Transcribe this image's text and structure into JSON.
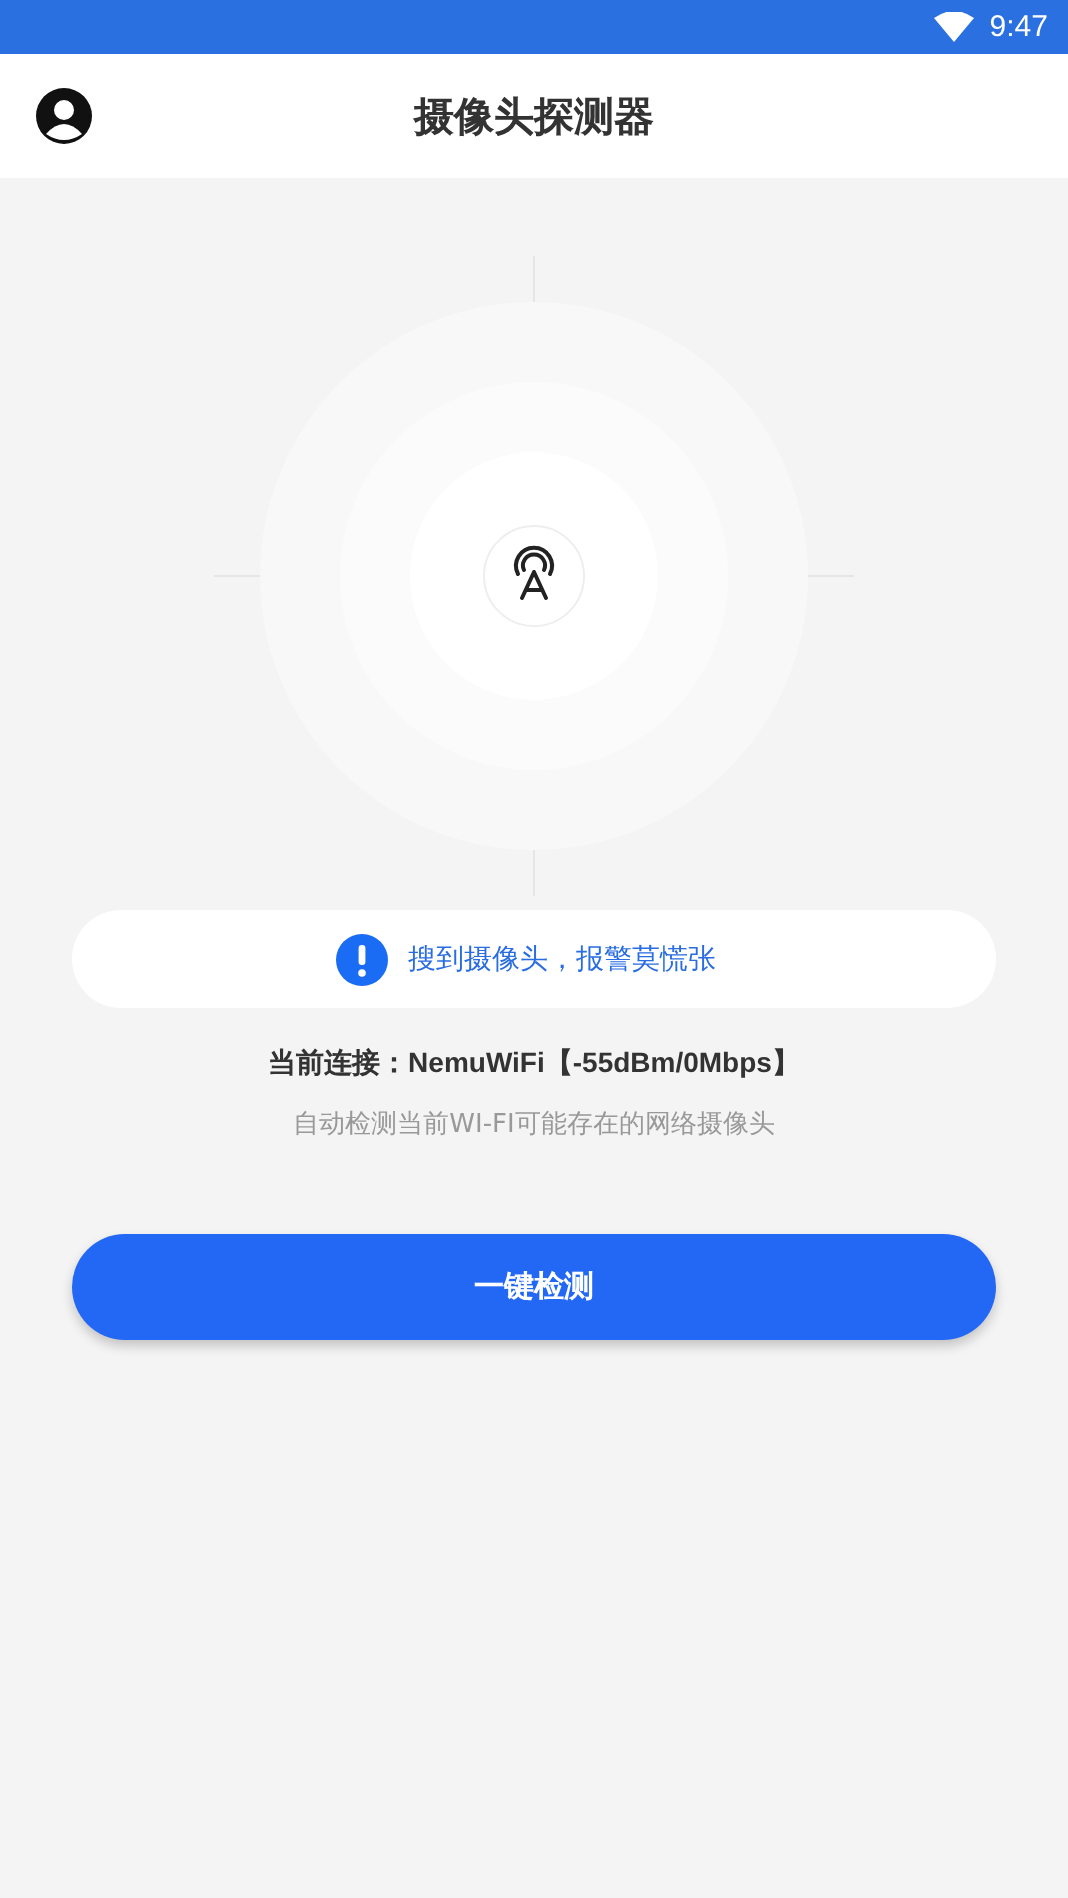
{
  "status_bar": {
    "time": "9:47"
  },
  "header": {
    "title": "摄像头探测器"
  },
  "alert": {
    "message": "搜到摄像头，报警莫慌张"
  },
  "connection": {
    "label": "当前连接：",
    "network": "NemuWiFi【-55dBm/0Mbps】"
  },
  "hint": "自动检测当前WI-FI可能存在的网络摄像头",
  "scan_button": {
    "label": "一键检测"
  }
}
